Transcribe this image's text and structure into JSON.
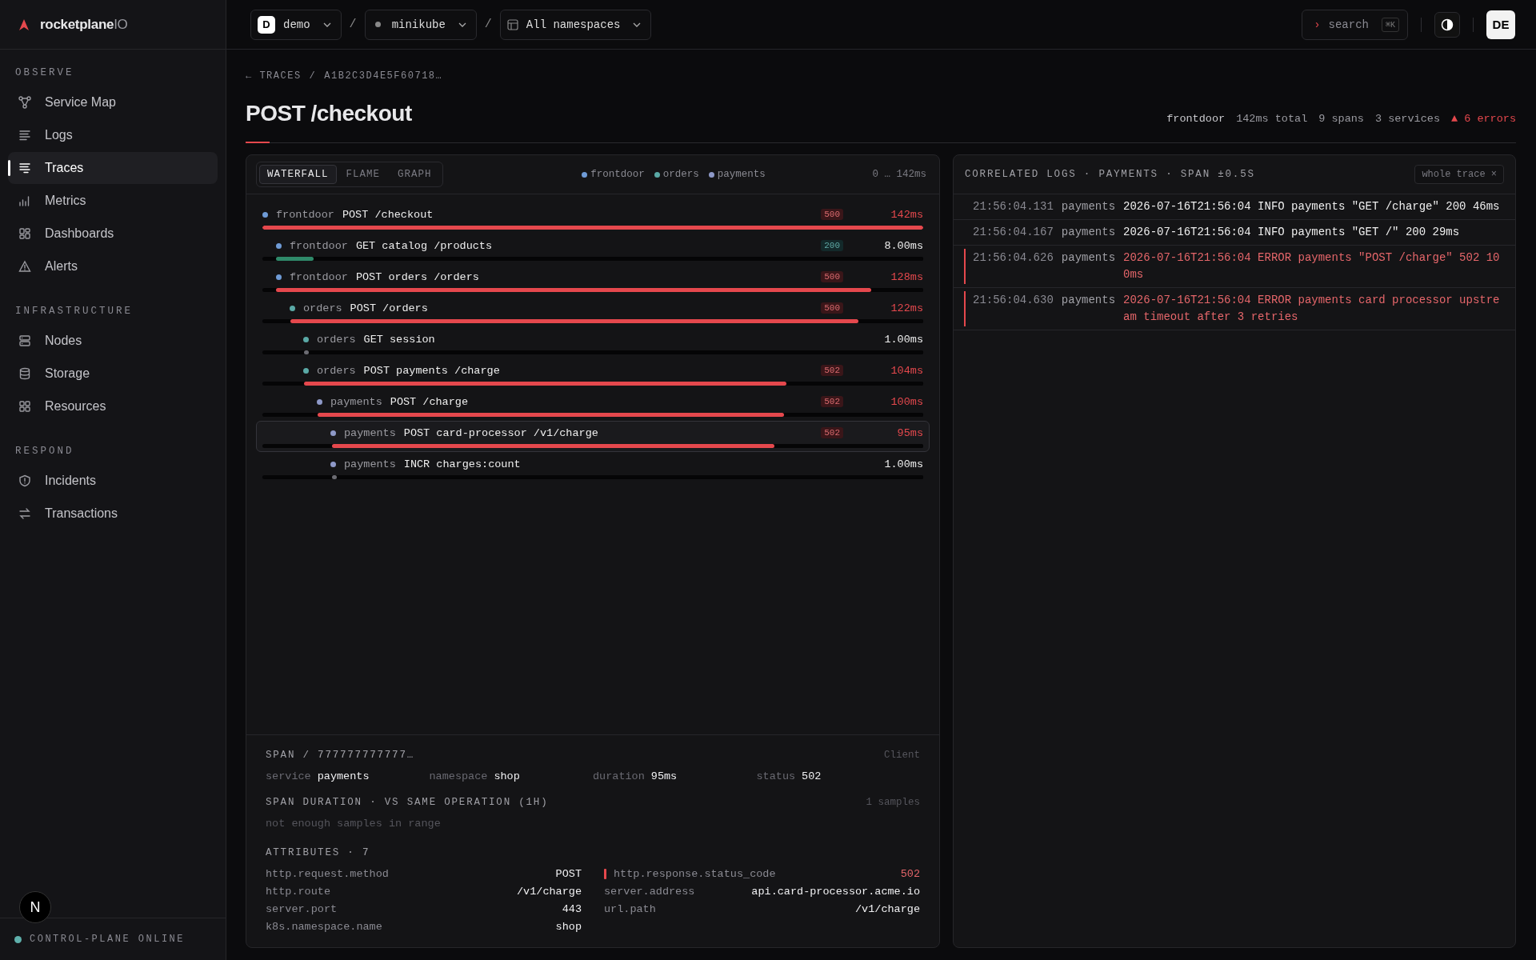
{
  "sidebar": {
    "brand": {
      "name": "rocketplane",
      "suffix": "IO"
    },
    "sections": [
      {
        "title": "OBSERVE",
        "items": [
          {
            "label": "Service Map",
            "selected": false
          },
          {
            "label": "Logs",
            "selected": false
          },
          {
            "label": "Traces",
            "selected": true
          },
          {
            "label": "Metrics",
            "selected": false
          },
          {
            "label": "Dashboards",
            "selected": false
          },
          {
            "label": "Alerts",
            "selected": false
          }
        ]
      },
      {
        "title": "INFRASTRUCTURE",
        "items": [
          {
            "label": "Nodes",
            "selected": false
          },
          {
            "label": "Storage",
            "selected": false
          },
          {
            "label": "Resources",
            "selected": false
          }
        ]
      },
      {
        "title": "RESPOND",
        "items": [
          {
            "label": "Incidents",
            "selected": false
          },
          {
            "label": "Transactions",
            "selected": false
          }
        ]
      }
    ],
    "status": {
      "label": "CONTROL-PLANE ONLINE",
      "online": true
    }
  },
  "dev_indicator": {
    "label": "N"
  },
  "topbar": {
    "workspace": {
      "badge": "D",
      "name": "demo"
    },
    "cluster": {
      "separator": "/",
      "name": "minikube"
    },
    "namespace": {
      "separator": "/",
      "name": "All namespaces"
    },
    "search": {
      "prompt": "›",
      "label": "search",
      "shortcut": "⌘K"
    },
    "avatar": "DE"
  },
  "trace": {
    "breadcrumb": {
      "back": "← TRACES",
      "separator": "/",
      "id": "A1B2C3D4E5F60718…"
    },
    "title": "POST /checkout",
    "stats": [
      {
        "text": "frontdoor",
        "kind": "service"
      },
      {
        "text": "142ms total",
        "kind": "plain"
      },
      {
        "text": "9 spans",
        "kind": "plain"
      },
      {
        "text": "3 services",
        "kind": "plain"
      },
      {
        "text": "▲ 6 errors",
        "kind": "error"
      }
    ]
  },
  "waterfall": {
    "tabs": [
      {
        "label": "WATERFALL",
        "selected": true
      },
      {
        "label": "FLAME",
        "selected": false
      },
      {
        "label": "GRAPH",
        "selected": false
      }
    ],
    "legend": [
      {
        "name": "frontdoor",
        "color": "#6f9bd6"
      },
      {
        "name": "orders",
        "color": "#5aa9a6"
      },
      {
        "name": "payments",
        "color": "#8e99c8"
      }
    ],
    "range": "0 … 142ms",
    "spans": [
      {
        "service": "frontdoor",
        "operation": "POST /checkout",
        "status": "500",
        "duration": "142ms",
        "kind": "error",
        "level": 1,
        "selected": false,
        "color": "#6f9bd6",
        "children": [
          {
            "service": "frontdoor",
            "operation": "GET catalog /products",
            "status": "200",
            "duration": "8.00ms",
            "kind": "ok",
            "level": 0.056,
            "selected": false,
            "color": "#6f9bd6"
          },
          {
            "service": "frontdoor",
            "operation": "POST orders /orders",
            "status": "500",
            "duration": "128ms",
            "kind": "error",
            "level": 0.9,
            "selected": false,
            "color": "#6f9bd6",
            "children": [
              {
                "service": "orders",
                "operation": "POST /orders",
                "status": "500",
                "duration": "122ms",
                "kind": "error",
                "level": 0.86,
                "selected": false,
                "color": "#5aa9a6",
                "children": [
                  {
                    "service": "orders",
                    "operation": "GET session",
                    "duration": "1.00ms",
                    "kind": "plain",
                    "level": 0.007,
                    "selected": false,
                    "color": "#5aa9a6"
                  },
                  {
                    "service": "orders",
                    "operation": "POST payments /charge",
                    "status": "502",
                    "duration": "104ms",
                    "kind": "error",
                    "level": 0.73,
                    "selected": false,
                    "color": "#5aa9a6",
                    "children": [
                      {
                        "service": "payments",
                        "operation": "POST /charge",
                        "status": "502",
                        "duration": "100ms",
                        "kind": "error",
                        "level": 0.705,
                        "selected": false,
                        "color": "#8e99c8",
                        "children": [
                          {
                            "service": "payments",
                            "operation": "POST card-processor /v1/charge",
                            "status": "502",
                            "duration": "95ms",
                            "kind": "error",
                            "level": 0.67,
                            "selected": true,
                            "color": "#8e99c8"
                          },
                          {
                            "service": "payments",
                            "operation": "INCR charges:count",
                            "duration": "1.00ms",
                            "kind": "plain",
                            "level": 0.007,
                            "selected": false,
                            "color": "#8e99c8"
                          }
                        ]
                      }
                    ]
                  }
                ]
              }
            ]
          }
        ]
      }
    ]
  },
  "detail": {
    "title": "SPAN / 777777777777…",
    "span_kind": "Client",
    "fields": [
      {
        "key": "service",
        "value": "payments"
      },
      {
        "key": "namespace",
        "value": "shop"
      },
      {
        "key": "duration",
        "value": "95ms"
      },
      {
        "key": "status",
        "value": "502"
      }
    ],
    "comparison": {
      "title": "SPAN DURATION · VS SAME OPERATION (1H)",
      "samples": "1 samples",
      "empty": "not enough samples in range"
    },
    "attributes": {
      "title": "ATTRIBUTES · 7",
      "items": [
        {
          "key": "http.request.method",
          "value": "POST",
          "flagged": false
        },
        {
          "key": "http.response.status_code",
          "value": "502",
          "flagged": true
        },
        {
          "key": "http.route",
          "value": "/v1/charge",
          "flagged": false
        },
        {
          "key": "server.address",
          "value": "api.card-processor.acme.io",
          "flagged": false
        },
        {
          "key": "server.port",
          "value": "443",
          "flagged": false
        },
        {
          "key": "url.path",
          "value": "/v1/charge",
          "flagged": false
        },
        {
          "key": "k8s.namespace.name",
          "value": "shop",
          "flagged": false
        }
      ]
    }
  },
  "logs": {
    "title": "CORRELATED LOGS · PAYMENTS · SPAN ±0.5S",
    "filter": "whole trace ×",
    "entries": [
      {
        "time": "21:56:04.131",
        "service": "payments",
        "message": "2026-07-16T21:56:04 INFO payments \"GET /charge\" 200 46ms",
        "kind": "info"
      },
      {
        "time": "21:56:04.167",
        "service": "payments",
        "message": "2026-07-16T21:56:04 INFO payments \"GET /\" 200 29ms",
        "kind": "info"
      },
      {
        "time": "21:56:04.626",
        "service": "payments",
        "message": "2026-07-16T21:56:04 ERROR payments \"POST /charge\" 502 100ms",
        "kind": "error"
      },
      {
        "time": "21:56:04.630",
        "service": "payments",
        "message": "2026-07-16T21:56:04 ERROR payments card processor upstream timeout after 3 retries",
        "kind": "error"
      }
    ]
  }
}
